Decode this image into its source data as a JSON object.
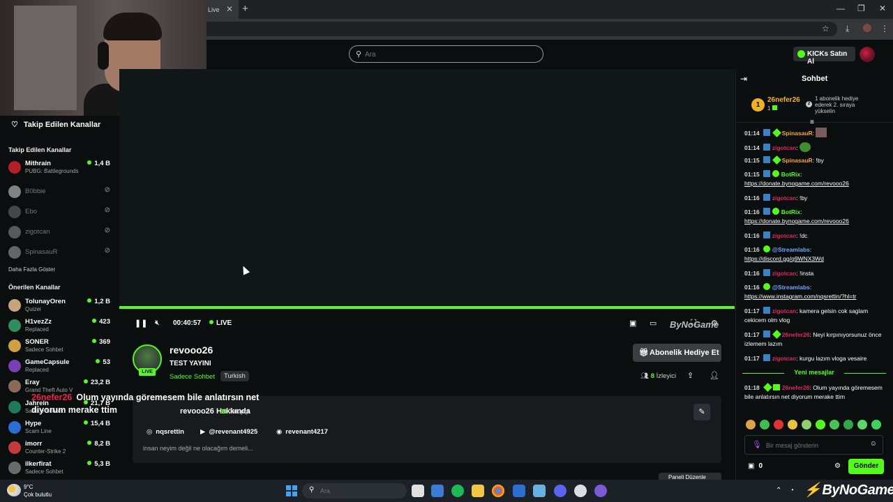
{
  "browser": {
    "tab_title": "Live",
    "tab_close": "✕",
    "new_tab": "+",
    "minimize": "—",
    "maximize": "❐",
    "close": "✕",
    "bookmark": "☆",
    "download": "⤓",
    "menu": "⋮"
  },
  "header": {
    "search_placeholder": "Ara",
    "kicks_label": "KICKs Satın Al"
  },
  "sidebar": {
    "followed_title": "Takip Edilen Kanallar",
    "followed_section": "Takip Edilen Kanallar",
    "followed": [
      {
        "name": "Mithrain",
        "sub": "PUBG: Battlegrounds",
        "viewers": "1,4 B",
        "online": true,
        "color": "#b3202a"
      },
      {
        "name": "B0bbie",
        "sub": "",
        "viewers": "⊘",
        "online": false,
        "color": "#d0d0d0"
      },
      {
        "name": "Ebo",
        "sub": "",
        "viewers": "⊘",
        "online": false,
        "color": "#6e6e6e"
      },
      {
        "name": "zigotcan",
        "sub": "",
        "viewers": "⊘",
        "online": false,
        "color": "#8a8a8a"
      },
      {
        "name": "SpinasauR",
        "sub": "",
        "viewers": "⊘",
        "online": false,
        "color": "#a0a0a0"
      }
    ],
    "show_more": "Daha Fazla Göster",
    "recommended_section": "Önerilen Kanallar",
    "recommended": [
      {
        "name": "TolunayOren",
        "sub": "Quizei",
        "viewers": "1,2 B",
        "color": "#c9a37a"
      },
      {
        "name": "H1vezZz",
        "sub": "Replaced",
        "viewers": "423",
        "color": "#2f8f5b"
      },
      {
        "name": "SONER",
        "sub": "Sadece Sohbet",
        "viewers": "369",
        "color": "#d2a040"
      },
      {
        "name": "GameCapsule",
        "sub": "Replaced",
        "viewers": "53",
        "color": "#7a3fb5"
      },
      {
        "name": "Eray",
        "sub": "Grand Theft Auto V",
        "viewers": "23,2 B",
        "color": "#8b6a55"
      },
      {
        "name": "Jahrein",
        "sub": "Sadece Sohbet",
        "viewers": "21,7 B",
        "color": "#1e7a58"
      },
      {
        "name": "Hype",
        "sub": "Scam Line",
        "viewers": "15,4 B",
        "color": "#2a6ed3"
      },
      {
        "name": "imorr",
        "sub": "Counter-Strike 2",
        "viewers": "8,2 B",
        "color": "#c23a3a"
      },
      {
        "name": "ilkerfirat",
        "sub": "Sadece Sohbet",
        "viewers": "5,3 B",
        "color": "#6a6a6a"
      }
    ]
  },
  "player": {
    "time": "00:40:57",
    "live": "LIVE",
    "watermark": "ByNoGame"
  },
  "channel": {
    "name": "revooo26",
    "live_badge": "LIVE",
    "title": "TEST YAYINI",
    "category": "Sadece Sohbet",
    "language": "Turkish",
    "gift_label": "Abonelik Hediye Et",
    "viewers_count": "8",
    "viewers_label": "İzleyici",
    "alert_user": "26nefer26",
    "alert_text": "Olum yayında göremesem bile anlatırsın net diyorum merake ttim",
    "about_title": "revooo26 Hakkında",
    "followers_count": "39",
    "followers_label": "Takipçi",
    "socials": [
      {
        "icon": "◎",
        "label": "nqsrettin"
      },
      {
        "icon": "▶",
        "label": "@revenant4925"
      },
      {
        "icon": "◉",
        "label": "revenant4217"
      }
    ],
    "bio": "insan neyim değil ne olacağım demeli...",
    "panel_button": "Paneli Düzenle"
  },
  "chat": {
    "title": "Sohbet",
    "pinned": {
      "rank": "1",
      "user": "26nefer26",
      "count": "1",
      "rank2": "2",
      "note": "1 abonelik hediye ederek 2. sıraya yükselin"
    },
    "messages": [
      {
        "time": "01:14",
        "user": "SpinasauR",
        "color": "#f5a623",
        "badge": "gift",
        "text": ""
      },
      {
        "time": "01:14",
        "user": "zigotcan",
        "color": "#e0245e",
        "badge": "",
        "text": ""
      },
      {
        "time": "01:15",
        "user": "SpinasauR",
        "color": "#f5a623",
        "badge": "gift",
        "text": "!by"
      },
      {
        "time": "01:15",
        "user": "BotRix",
        "color": "#53fc18",
        "badge": "verified",
        "text": "",
        "link": "https://donate.bynogame.com/revooo26"
      },
      {
        "time": "01:16",
        "user": "zigotcan",
        "color": "#e0245e",
        "badge": "",
        "text": "!by"
      },
      {
        "time": "01:16",
        "user": "BotRix",
        "color": "#53fc18",
        "badge": "verified",
        "text": "",
        "link": "https://donate.bynogame.com/revooo26"
      },
      {
        "time": "01:16",
        "user": "zigotcan",
        "color": "#e0245e",
        "badge": "",
        "text": "!dc"
      },
      {
        "time": "01:16",
        "user": "@Streamlabs",
        "color": "#6aa8ff",
        "badge": "verified",
        "text": "",
        "link": "https://discord.gg/q9WNX3Wd"
      },
      {
        "time": "01:16",
        "user": "zigotcan",
        "color": "#e0245e",
        "badge": "",
        "text": "!insta"
      },
      {
        "time": "01:16",
        "user": "@Streamlabs",
        "color": "#6aa8ff",
        "badge": "verified",
        "text": "",
        "link": "https://www.instagram.com/nqsrettin/?hl=tr"
      },
      {
        "time": "01:17",
        "user": "zigotcan",
        "color": "#e0245e",
        "badge": "",
        "text": "kamera gelsin cok saglam cekicem olm vlog"
      },
      {
        "time": "01:17",
        "user": "26nefer26",
        "color": "#e0245e",
        "badge": "gift",
        "text": "Neyi kırpınıyorsunuz önce izlemem lazım"
      },
      {
        "time": "01:17",
        "user": "zigotcan",
        "color": "#e0245e",
        "badge": "",
        "text": "kurgu lazım vloga vesaire"
      }
    ],
    "new_messages": "Yeni mesajlar",
    "latest": {
      "time": "01:18",
      "user": "26nefer26",
      "color": "#e0245e",
      "text": "Olum yayında göremesem bile anlatırsın net diyorum merake ttim"
    },
    "input_placeholder": "Bir mesaj gönderin",
    "points": "0",
    "send_label": "Gönder"
  },
  "taskbar": {
    "temp": "9°C",
    "weather": "Çok bulutlu",
    "search_placeholder": "Ara",
    "brand": "ByNoGame",
    "brand_mark": "⚡"
  }
}
